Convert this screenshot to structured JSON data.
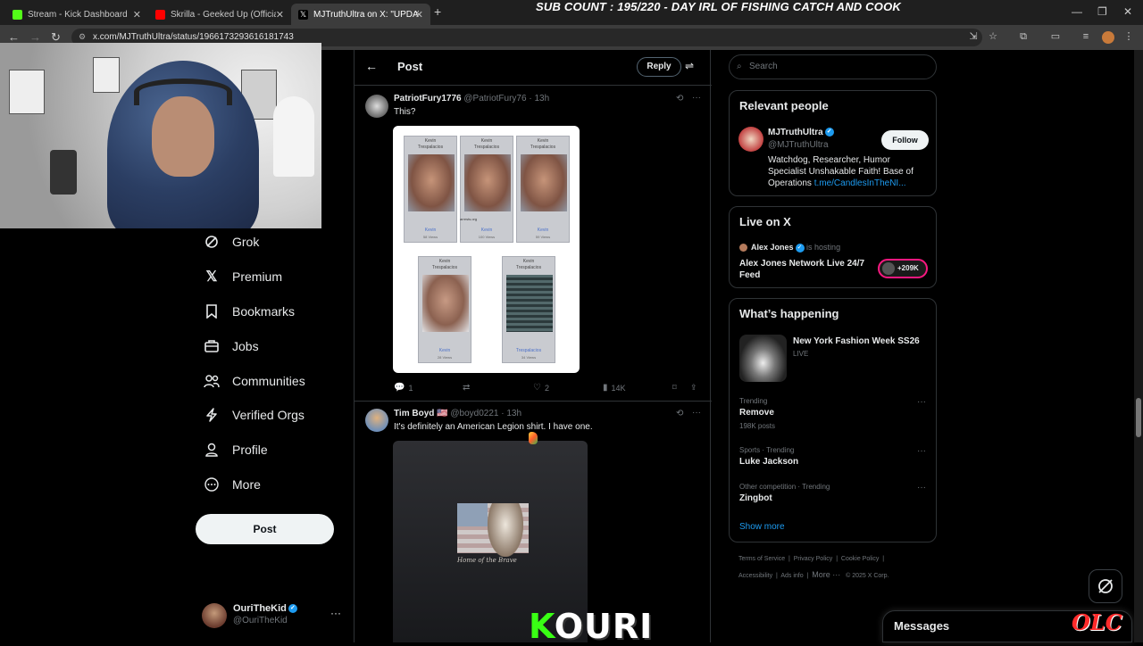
{
  "browser": {
    "tabs": [
      {
        "title": "Stream - Kick Dashboard",
        "favicon_color": "#53fc18"
      },
      {
        "title": "Skrilla - Geeked Up (Official Vid",
        "favicon_color": "#ff0000"
      },
      {
        "title": "MJTruthUltra on X: \"UPDATE: C",
        "favicon_color": "#000000"
      }
    ],
    "new_tab": "+",
    "url": "x.com/MJTruthUltra/status/1966173293616181743",
    "overlay_title": "SUB COUNT : 195/220 - DAY IRL OF FISHING CATCH AND COOK"
  },
  "sidebar": {
    "items": [
      {
        "label": "Grok",
        "icon": "grok-icon"
      },
      {
        "label": "Premium",
        "icon": "x-logo-icon"
      },
      {
        "label": "Bookmarks",
        "icon": "bookmark-icon"
      },
      {
        "label": "Jobs",
        "icon": "briefcase-icon"
      },
      {
        "label": "Communities",
        "icon": "people-icon"
      },
      {
        "label": "Verified Orgs",
        "icon": "lightning-icon"
      },
      {
        "label": "Profile",
        "icon": "person-icon"
      },
      {
        "label": "More",
        "icon": "more-circle-icon"
      }
    ],
    "post_button": "Post",
    "account": {
      "name": "OuriTheKid",
      "handle": "@OuriTheKid"
    }
  },
  "main": {
    "title": "Post",
    "reply_button": "Reply",
    "tweets": [
      {
        "name": "PatriotFury1776",
        "handle": "@PatriotFury76",
        "time": "· 13h",
        "text": "This?",
        "replies": "1",
        "retweets": "",
        "likes": "2",
        "views": "14K"
      },
      {
        "name": "Tim Boyd 🇺🇸",
        "handle": "@boyd0221",
        "time": "· 13h",
        "text": "It's definitely an American Legion shirt. I have one."
      }
    ],
    "mugshots": [
      {
        "name_line1": "Kevin",
        "name_line2": "Trespalacios",
        "link": "Kevin",
        "views": "58 Views"
      },
      {
        "name_line1": "Kevin",
        "name_line2": "Trespalacios",
        "link": "Kevin",
        "views": "100 Views"
      },
      {
        "name_line1": "Kevin",
        "name_line2": "Trespalacios",
        "link": "Kevin",
        "views": "59 Views"
      },
      {
        "name_line1": "Kevin",
        "name_line2": "Trespalacios",
        "link": "Kevin",
        "views": "28 Views"
      },
      {
        "name_line1": "Kevin",
        "name_line2": "Trespalacios",
        "link": "Trespalacios",
        "views": "34 Views"
      }
    ],
    "mugshot_watermark": "arrests.org",
    "shirt_caption": "Home of the Brave"
  },
  "right": {
    "search_placeholder": "Search",
    "relevant": {
      "title": "Relevant people",
      "name": "MJTruthUltra",
      "handle": "@MJTruthUltra",
      "follow": "Follow",
      "bio_line1": "Watchdog, Researcher, Humor",
      "bio_line2": "Specialist Unshakable Faith! Base of",
      "bio_line3": "Operations",
      "bio_link": "t.me/CandlesInTheNI..."
    },
    "live": {
      "title": "Live on X",
      "host": "Alex Jones",
      "hosting": "is hosting",
      "stream_title_line1": "Alex Jones Network Live 24/7",
      "stream_title_line2": "Feed",
      "viewers": "+209K"
    },
    "happening": {
      "title": "What’s happening",
      "featured_title": "New York Fashion Week SS26",
      "featured_status": "LIVE",
      "trends": [
        {
          "context": "Trending",
          "topic": "Remove",
          "posts": "198K posts"
        },
        {
          "context": "Sports · Trending",
          "topic": "Luke Jackson",
          "posts": ""
        },
        {
          "context": "Other competition · Trending",
          "topic": "Zingbot",
          "posts": ""
        }
      ],
      "show_more": "Show more"
    },
    "footer": {
      "line1": [
        "Terms of Service",
        "Privacy Policy",
        "Cookie Policy"
      ],
      "line2": [
        "Accessibility",
        "Ads info",
        "More ···",
        "© 2025 X Corp."
      ]
    }
  },
  "overlays": {
    "kouri_k": "K",
    "kouri_rest": "OURI",
    "messages": "Messages",
    "olc": "OLC"
  }
}
